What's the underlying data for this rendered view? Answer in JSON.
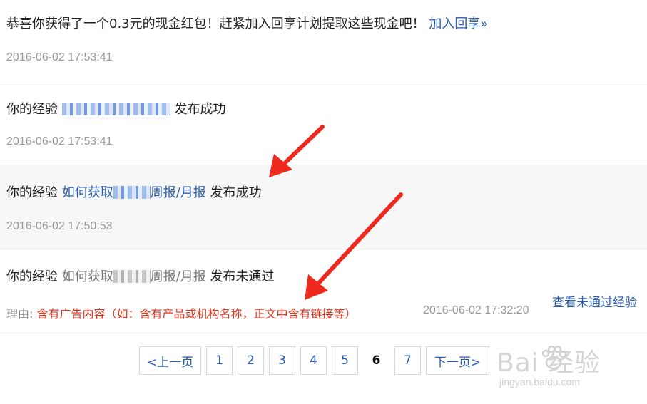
{
  "messages": [
    {
      "text": "恭喜你获得了一个0.3元的现金红包！赶紧加入回享计划提取这些现金吧！",
      "link": "加入回享»",
      "time": "2016-06-02 17:53:41"
    },
    {
      "prefix": "你的经验",
      "suffix": "发布成功",
      "time": "2016-06-02 17:53:41"
    },
    {
      "prefix": "你的经验",
      "title_start": "如何获取",
      "title_end": "周报/月报",
      "suffix": "发布成功",
      "time": "2016-06-02 17:50:53"
    },
    {
      "prefix": "你的经验",
      "title_start": "如何获取",
      "title_end": "周报/月报",
      "suffix": "发布未通过",
      "reason_label": "理由:",
      "reason_text": "含有广告内容（如：含有产品或机构名称，正文中含有链接等）",
      "time": "2016-06-02 17:32:20",
      "action": "查看未通过经验"
    }
  ],
  "pagination": {
    "prev": "<上一页",
    "pages": [
      "1",
      "2",
      "3",
      "4",
      "5",
      "6",
      "7"
    ],
    "current": "6",
    "next": "下一页>"
  },
  "watermark": {
    "logo": "Bai 经验",
    "url": "jingyan.baidu.com"
  },
  "colors": {
    "link": "#2a5db0",
    "reason": "#e4341c",
    "annotation_arrow": "#ee2a1e"
  }
}
